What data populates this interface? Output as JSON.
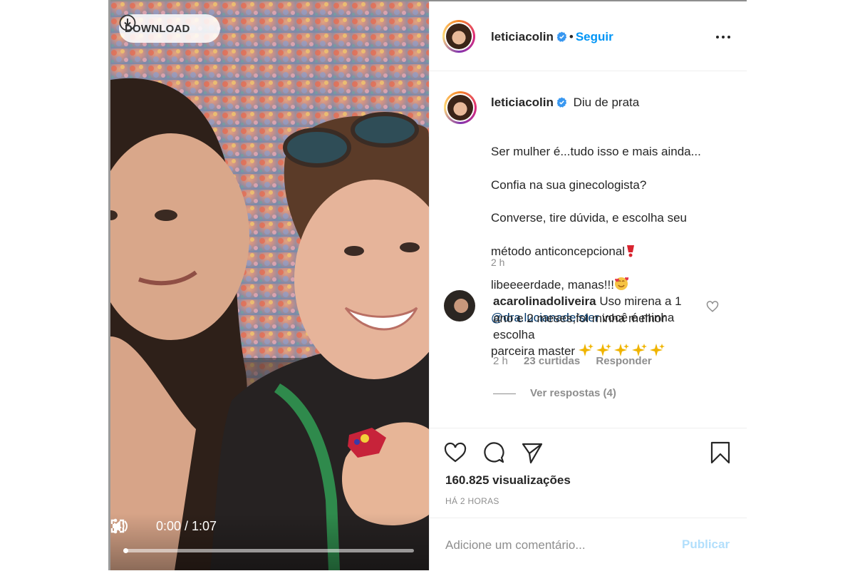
{
  "video": {
    "download_label": "DOWNLOAD",
    "time": "0:00 / 1:07",
    "progress": 0
  },
  "header": {
    "username": "leticiacolin",
    "separator": "•",
    "follow_label": "Seguir"
  },
  "caption": {
    "username": "leticiacolin",
    "title": "Diu de prata",
    "line1": "Ser mulher é...tudo isso e mais ainda...",
    "line2": "Confia na sua ginecologista?",
    "line3": "Converse, tire dúvida, e escolha seu",
    "line4": "método anticoncepcional",
    "line5": "libeeeerdade, manas!!!",
    "mention": "@dra.lucianadeister",
    "line6": " você é minha",
    "line7": "parceira master ",
    "time": "2 h"
  },
  "comment": {
    "username": "acarolinadoliveira",
    "text": "Uso mirena a 1 ano e 2 meses,foi minha melhor escolha",
    "time": "2 h",
    "likes": "23 curtidas",
    "reply_label": "Responder",
    "view_replies": "Ver respostas (4)"
  },
  "stats": {
    "views": "160.825 visualizações",
    "ago": "HÁ 2 HORAS"
  },
  "comment_box": {
    "placeholder": "Adicione um comentário...",
    "publish_label": "Publicar"
  },
  "colors": {
    "follow": "#0095f6",
    "verified": "#3897f0",
    "publish_disabled": "#b2dffc",
    "mention": "#00376b"
  }
}
